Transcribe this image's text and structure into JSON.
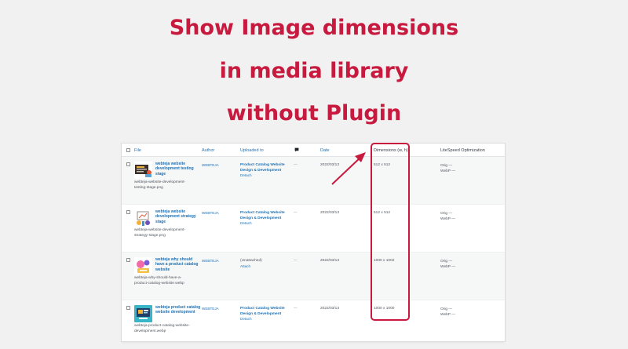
{
  "headline": {
    "line1": "Show Image dimensions",
    "line2": "in media library",
    "line3": "without Plugin"
  },
  "table": {
    "columns": {
      "file": "File",
      "author": "Author",
      "uploaded_to": "Uploaded to",
      "comments_icon": "comment-bubble-icon",
      "date": "Date",
      "dimensions": "Dimensions (w, h)",
      "optimization": "LiteSpeed Optimization"
    },
    "rows": [
      {
        "title": "webteja website development testing stage",
        "filename": "webteja-website-development-testing-stage.png",
        "author": "WEBTEJA",
        "uploaded_to": "Product Catalog Website Design & Development",
        "action": "Detach",
        "comments": "—",
        "date": "2022/03/13",
        "dimensions": "512 x 512",
        "orig": "Orig —",
        "webp": "WebP —"
      },
      {
        "title": "webteja website development strategy stage",
        "filename": "webteja-website-development-strategy-stage.png",
        "author": "WEBTEJA",
        "uploaded_to": "Product Catalog Website Design & Development",
        "action": "Detach",
        "comments": "—",
        "date": "2022/03/13",
        "dimensions": "512 x 512",
        "orig": "Orig —",
        "webp": "WebP —"
      },
      {
        "title": "webteja why should have a product catalog website",
        "filename": "webteja-why-should-have-a-product-catalog-website.webp",
        "author": "WEBTEJA",
        "uploaded_to": "(Unattached)",
        "action": "Attach",
        "comments": "—",
        "date": "2022/03/13",
        "dimensions": "1000 x 1002",
        "orig": "Orig —",
        "webp": "WebP —"
      },
      {
        "title": "webteja product catalog website development",
        "filename": "webteja-product-catalog-website-development.webp",
        "author": "WEBTEJA",
        "uploaded_to": "Product Catalog Website Design & Development",
        "action": "Detach",
        "comments": "—",
        "date": "2022/03/13",
        "dimensions": "1000 x 1000",
        "orig": "Orig —",
        "webp": "WebP —"
      }
    ]
  },
  "colors": {
    "accent": "#c8193e",
    "link": "#2271b1",
    "background": "#f1f1f1"
  }
}
